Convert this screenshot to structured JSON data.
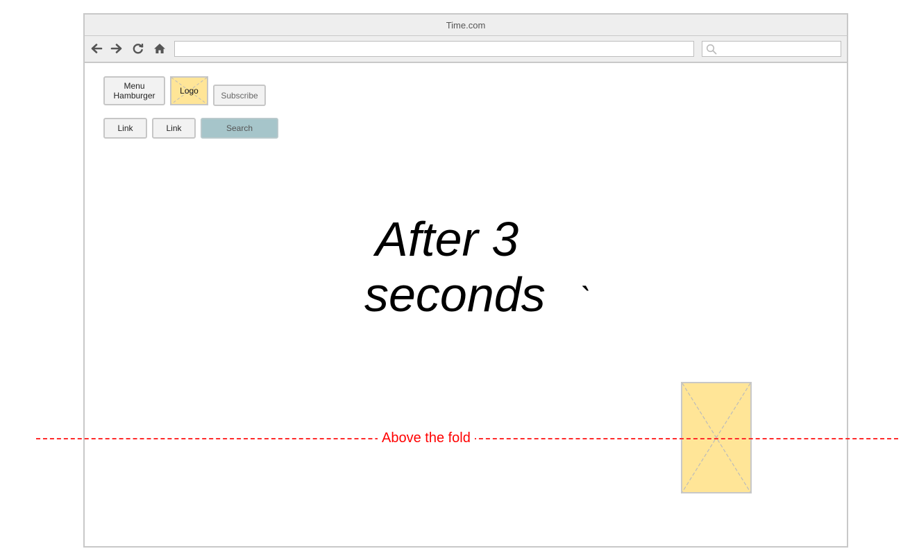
{
  "window": {
    "title": "Time.com",
    "url_value": "",
    "search_value": ""
  },
  "toolbar_icons": [
    "back-arrow-icon",
    "forward-arrow-icon",
    "reload-icon",
    "home-icon",
    "search-icon"
  ],
  "header": {
    "menu_label_line1": "Menu",
    "menu_label_line2": "Hamburger",
    "logo_label": "Logo",
    "subscribe_label": "Subscribe",
    "links": [
      "Link",
      "Link"
    ],
    "search_label": "Search"
  },
  "main": {
    "headline_line1": "After 3",
    "headline_line2": "seconds",
    "stray_mark": "`"
  },
  "fold": {
    "label": "Above the fold",
    "color": "#ff0000"
  },
  "colors": {
    "placeholder_fill": "#ffe597",
    "search_button_fill": "#a6c5ca",
    "chrome_gray": "#eeeeee"
  }
}
